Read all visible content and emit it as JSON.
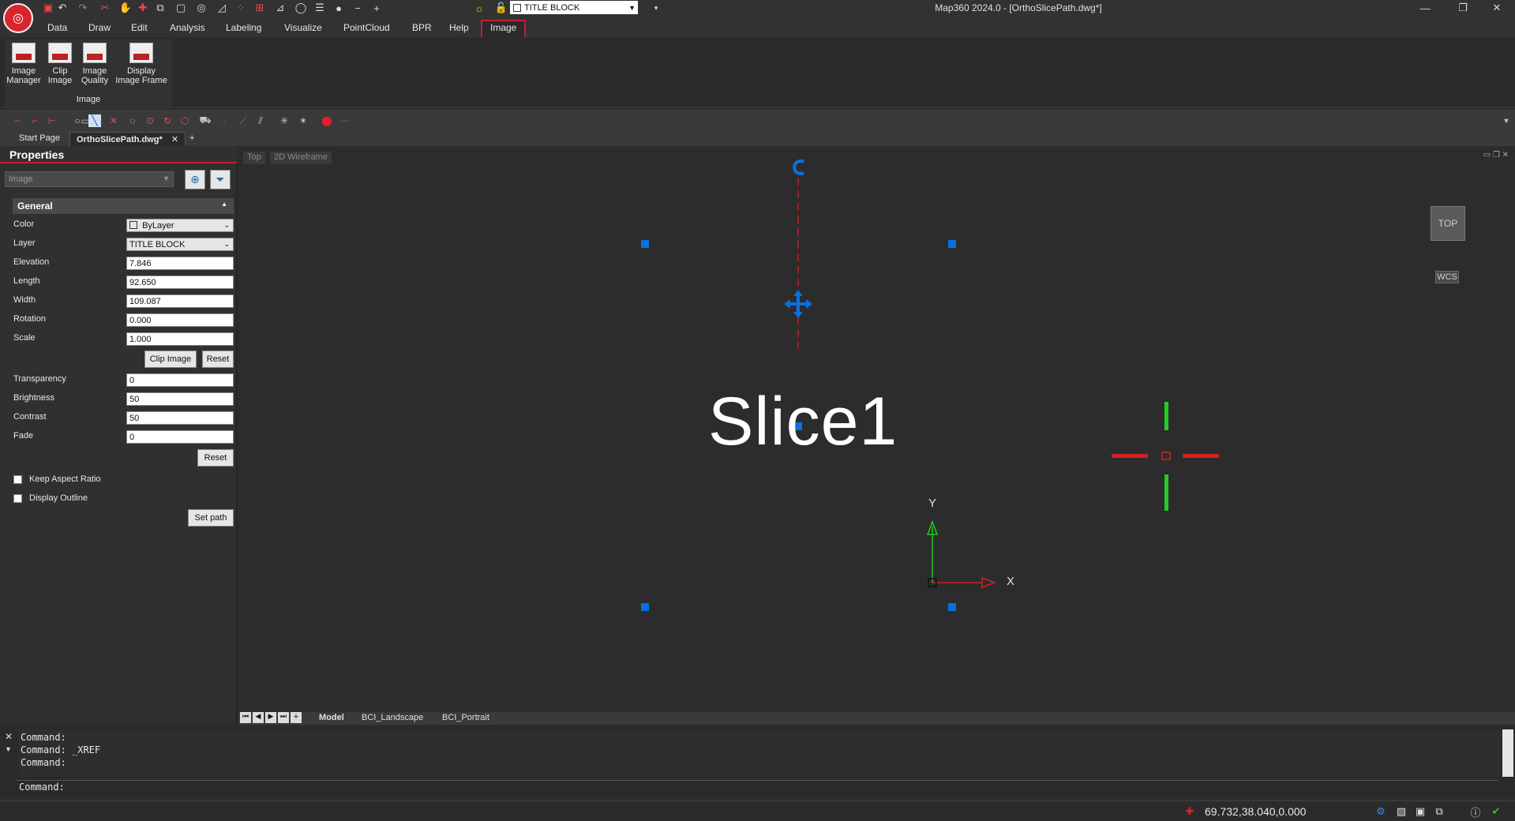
{
  "app": {
    "window_title": "Map360 2024.0 - [OrthoSlicePath.dwg*]",
    "layer_combo": "TITLE BLOCK"
  },
  "menu": [
    "Data",
    "Draw",
    "Edit",
    "Analysis",
    "Labeling",
    "Visualize",
    "PointCloud",
    "BPR",
    "Help",
    "Image"
  ],
  "ribbon": {
    "buttons": [
      {
        "line1": "Image",
        "line2": "Manager"
      },
      {
        "line1": "Clip",
        "line2": "Image"
      },
      {
        "line1": "Image",
        "line2": "Quality"
      },
      {
        "line1": "Display",
        "line2": "Image Frame"
      }
    ],
    "group_label": "Image"
  },
  "doc_tabs": {
    "start": "Start Page",
    "active": "OrthoSlicePath.dwg*"
  },
  "properties": {
    "title": "Properties",
    "entity_type": "Image",
    "section": "General",
    "color_label": "Color",
    "color_value": "ByLayer",
    "layer_label": "Layer",
    "layer_value": "TITLE BLOCK",
    "elevation_label": "Elevation",
    "elevation_value": "7.846",
    "length_label": "Length",
    "length_value": "92.650",
    "width_label": "Width",
    "width_value": "109.087",
    "rotation_label": "Rotation",
    "rotation_value": "0.000",
    "scale_label": "Scale",
    "scale_value": "1.000",
    "clip_image": "Clip Image",
    "reset": "Reset",
    "transparency_label": "Transparency",
    "transparency_value": "0",
    "brightness_label": "Brightness",
    "brightness_value": "50",
    "contrast_label": "Contrast",
    "contrast_value": "50",
    "fade_label": "Fade",
    "fade_value": "0",
    "reset2": "Reset",
    "keep_aspect": "Keep Aspect Ratio",
    "display_outline": "Display Outline",
    "set_path": "Set path"
  },
  "canvas": {
    "view_top": "Top",
    "view_style": "2D Wireframe",
    "viewcube": "TOP",
    "wcs": "WCS",
    "slice_text": "Slice1",
    "axis_y": "Y",
    "axis_x": "X"
  },
  "layouts": [
    "Model",
    "BCI_Landscape",
    "BCI_Portrait"
  ],
  "command": {
    "history": "Command:\nCommand: _XREF\nCommand:",
    "prompt": "Command:"
  },
  "status": {
    "coords": "69.732,38.040,0.000"
  },
  "colors": {
    "accent_red": "#c0202a",
    "grip_blue": "#0a6fe0",
    "axis_green": "#22cc22"
  }
}
